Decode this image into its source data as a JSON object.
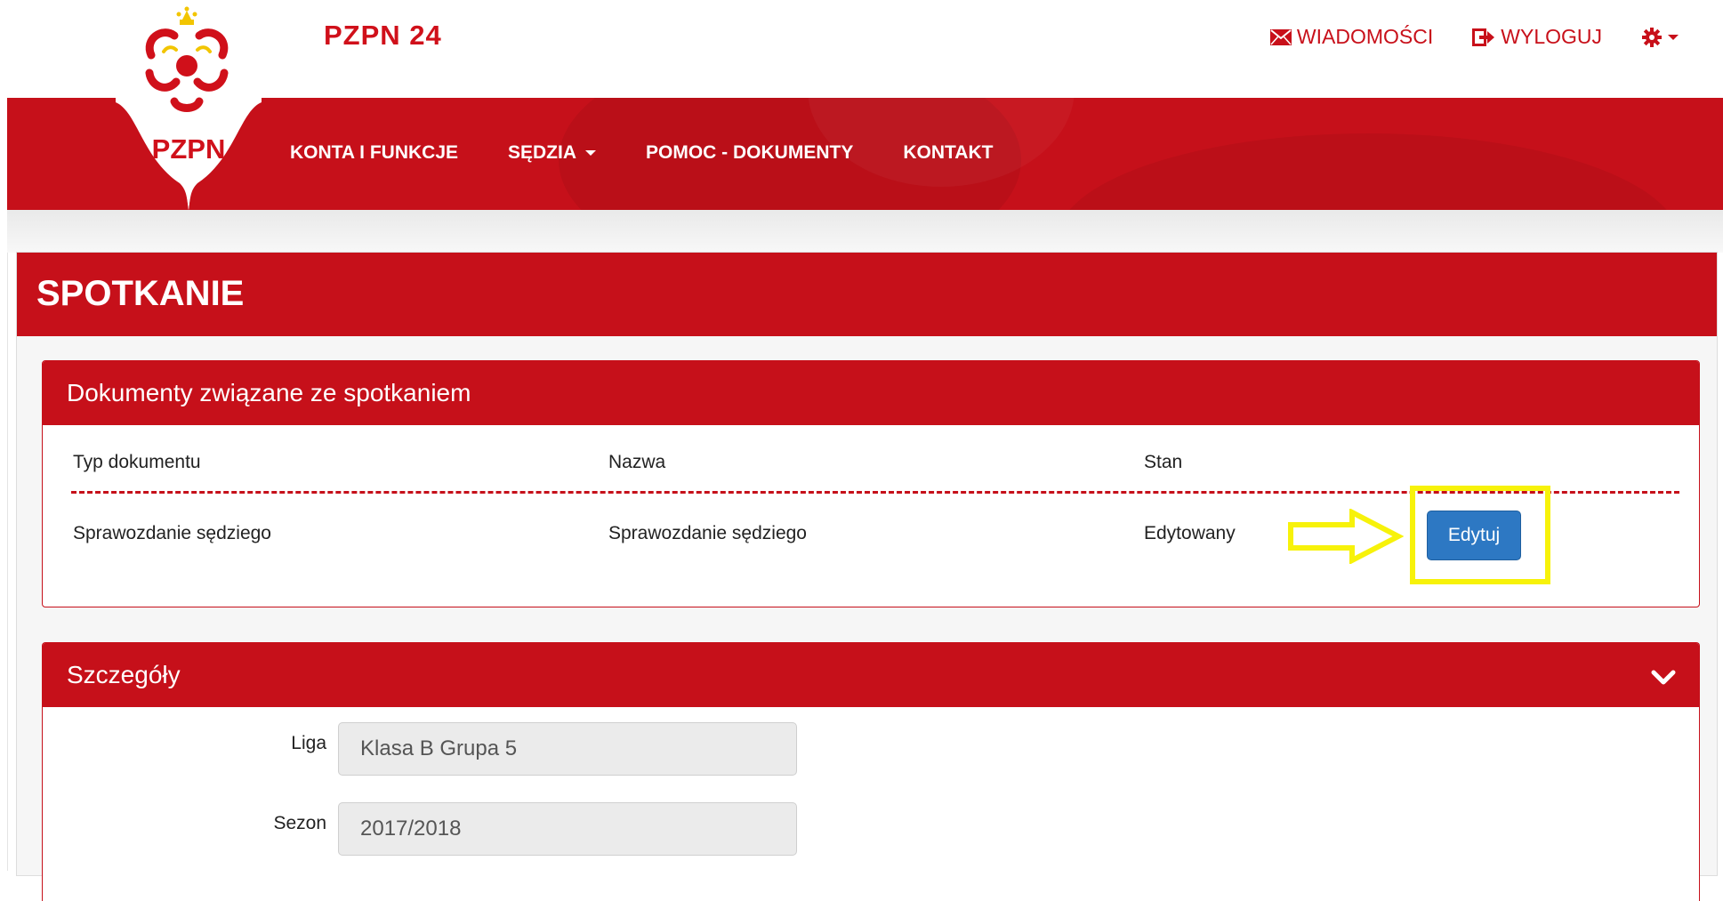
{
  "brand": {
    "title": "PZPN 24",
    "logo_text": "PZPN"
  },
  "top_links": {
    "messages": "WIADOMOŚCI",
    "logout": "WYLOGUJ"
  },
  "nav": [
    {
      "label": "KONTA I FUNKCJE",
      "dropdown": false
    },
    {
      "label": "SĘDZIA",
      "dropdown": true
    },
    {
      "label": "POMOC - DOKUMENTY",
      "dropdown": false
    },
    {
      "label": "KONTAKT",
      "dropdown": false
    }
  ],
  "page": {
    "title": "SPOTKANIE"
  },
  "documents_panel": {
    "title": "Dokumenty związane ze spotkaniem",
    "columns": [
      "Typ dokumentu",
      "Nazwa",
      "Stan"
    ],
    "rows": [
      {
        "type": "Sprawozdanie sędziego",
        "name": "Sprawozdanie sędziego",
        "status": "Edytowany",
        "action": "Edytuj"
      }
    ]
  },
  "details_panel": {
    "title": "Szczegóły",
    "fields": [
      {
        "label": "Liga",
        "value": "Klasa B Grupa 5"
      },
      {
        "label": "Sezon",
        "value": "2017/2018"
      }
    ]
  },
  "colors": {
    "primary_red": "#c6101a",
    "button_blue": "#2d78c3",
    "highlight_yellow": "#f7f20a"
  },
  "icons": {
    "messages": "envelope-icon",
    "logout": "logout-icon",
    "settings": "gear-icon",
    "collapse": "chevron-down-icon"
  }
}
